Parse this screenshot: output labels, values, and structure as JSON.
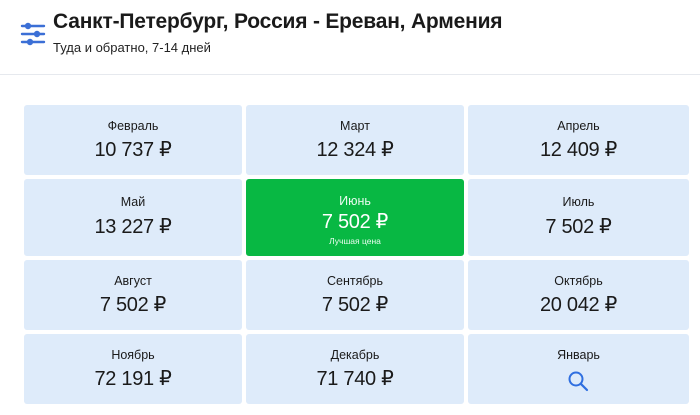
{
  "header": {
    "title": "Санкт-Петербург, Россия - Ереван, Армения",
    "subtitle": "Туда и обратно, 7-14 дней",
    "filter_icon": "filter-sliders-icon",
    "accent_color": "#3b6fd6"
  },
  "months": [
    {
      "name": "Февраль",
      "price": "10 737 ₽"
    },
    {
      "name": "Март",
      "price": "12 324 ₽"
    },
    {
      "name": "Апрель",
      "price": "12 409 ₽"
    },
    {
      "name": "Май",
      "price": "13 227 ₽"
    },
    {
      "name": "Июнь",
      "price": "7 502 ₽",
      "badge": "Лучшая цена"
    },
    {
      "name": "Июль",
      "price": "7 502 ₽"
    },
    {
      "name": "Август",
      "price": "7 502 ₽"
    },
    {
      "name": "Сентябрь",
      "price": "7 502 ₽"
    },
    {
      "name": "Октябрь",
      "price": "20 042 ₽"
    },
    {
      "name": "Ноябрь",
      "price": "72 191 ₽"
    },
    {
      "name": "Декабрь",
      "price": "71 740 ₽"
    },
    {
      "name": "Январь",
      "icon": "search-icon"
    }
  ],
  "colors": {
    "cell_bg": "#deebfa",
    "best_bg": "#08b843",
    "icon_blue": "#2f6fe0"
  }
}
